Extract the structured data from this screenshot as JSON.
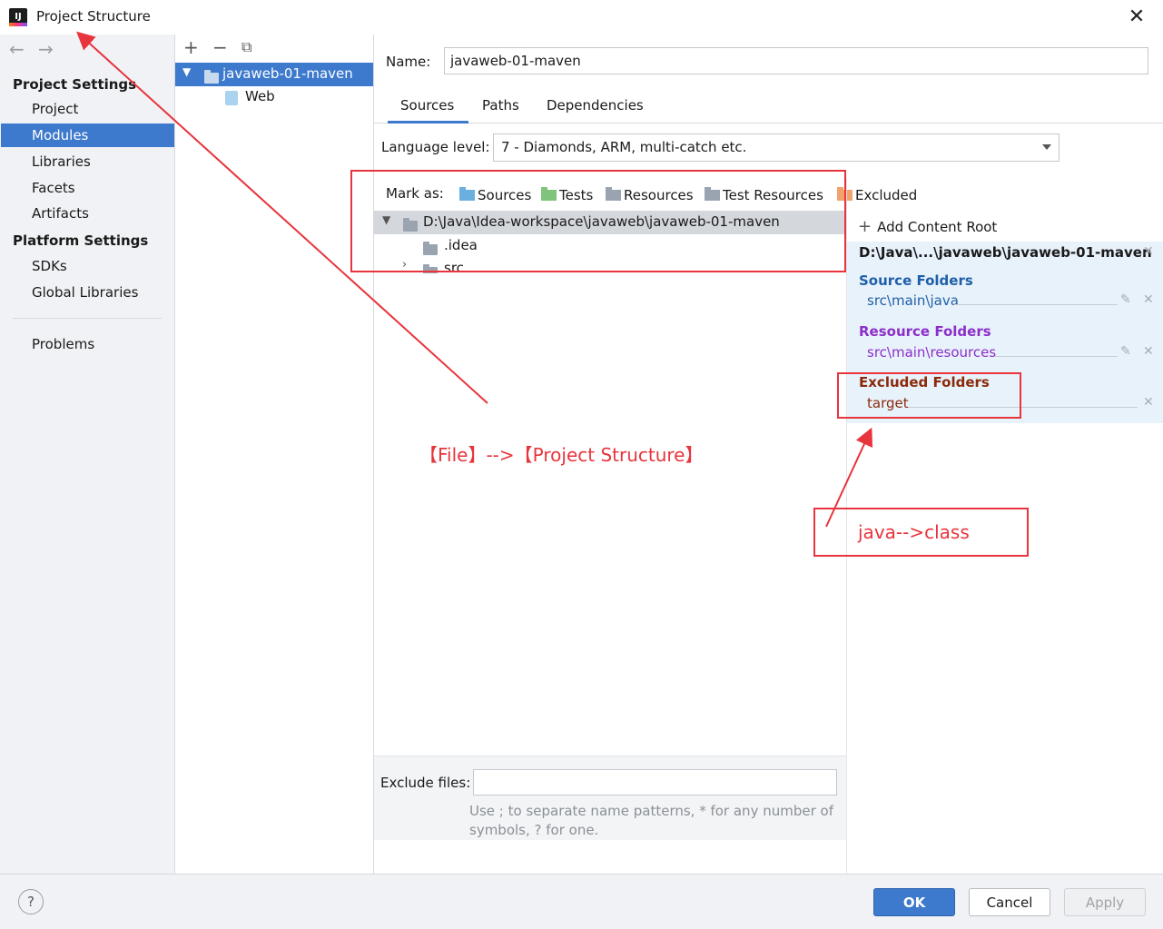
{
  "window": {
    "title": "Project Structure",
    "app_icon_text": "IJ"
  },
  "nav": {
    "project_settings": "Project Settings",
    "project_items": [
      "Project",
      "Modules",
      "Libraries",
      "Facets",
      "Artifacts"
    ],
    "selected": "Modules",
    "platform_settings": "Platform Settings",
    "platform_items": [
      "SDKs",
      "Global Libraries"
    ],
    "problems": "Problems"
  },
  "module_tree": {
    "module": "javaweb-01-maven",
    "child": "Web"
  },
  "module": {
    "name_label": "Name:",
    "name_value": "javaweb-01-maven",
    "tabs": [
      "Sources",
      "Paths",
      "Dependencies"
    ],
    "active_tab": "Sources",
    "language_level_label": "Language level:",
    "language_level_value": "7 - Diamonds, ARM, multi-catch etc.",
    "mark_as_label": "Mark as:",
    "mark_as": [
      {
        "label": "Sources",
        "color": "#6ab0de"
      },
      {
        "label": "Tests",
        "color": "#7fc47b"
      },
      {
        "label": "Resources",
        "color": "#9aa4b0"
      },
      {
        "label": "Test Resources",
        "color": "#9aa4b0"
      },
      {
        "label": "Excluded",
        "color": "#f0a36b"
      }
    ],
    "file_tree": {
      "root": "D:\\Java\\Idea-workspace\\javaweb\\javaweb-01-maven",
      "children": [
        ".idea",
        "src"
      ]
    },
    "exclude_files_label": "Exclude files:",
    "exclude_files_value": "",
    "hint_line1": "Use ; to separate name patterns, * for any number of",
    "hint_line2": "symbols, ? for one."
  },
  "content_root": {
    "add_label": "Add Content Root",
    "root_path": "D:\\Java\\...\\javaweb\\javaweb-01-maven",
    "source_folders_label": "Source Folders",
    "source_folder": "src\\main\\java",
    "resource_folders_label": "Resource Folders",
    "resource_folder": "src\\main\\resources",
    "excluded_folders_label": "Excluded Folders",
    "excluded_folder": "target",
    "colors": {
      "source": "#1f5fa8",
      "resource": "#8b2fc9",
      "excluded": "#8b2a0a"
    }
  },
  "footer": {
    "help": "?",
    "ok": "OK",
    "cancel": "Cancel",
    "apply": "Apply"
  },
  "annotations": {
    "menu_path": "【File】-->【Project Structure】",
    "compile_note": "java-->class",
    "color": "#e8343c"
  }
}
